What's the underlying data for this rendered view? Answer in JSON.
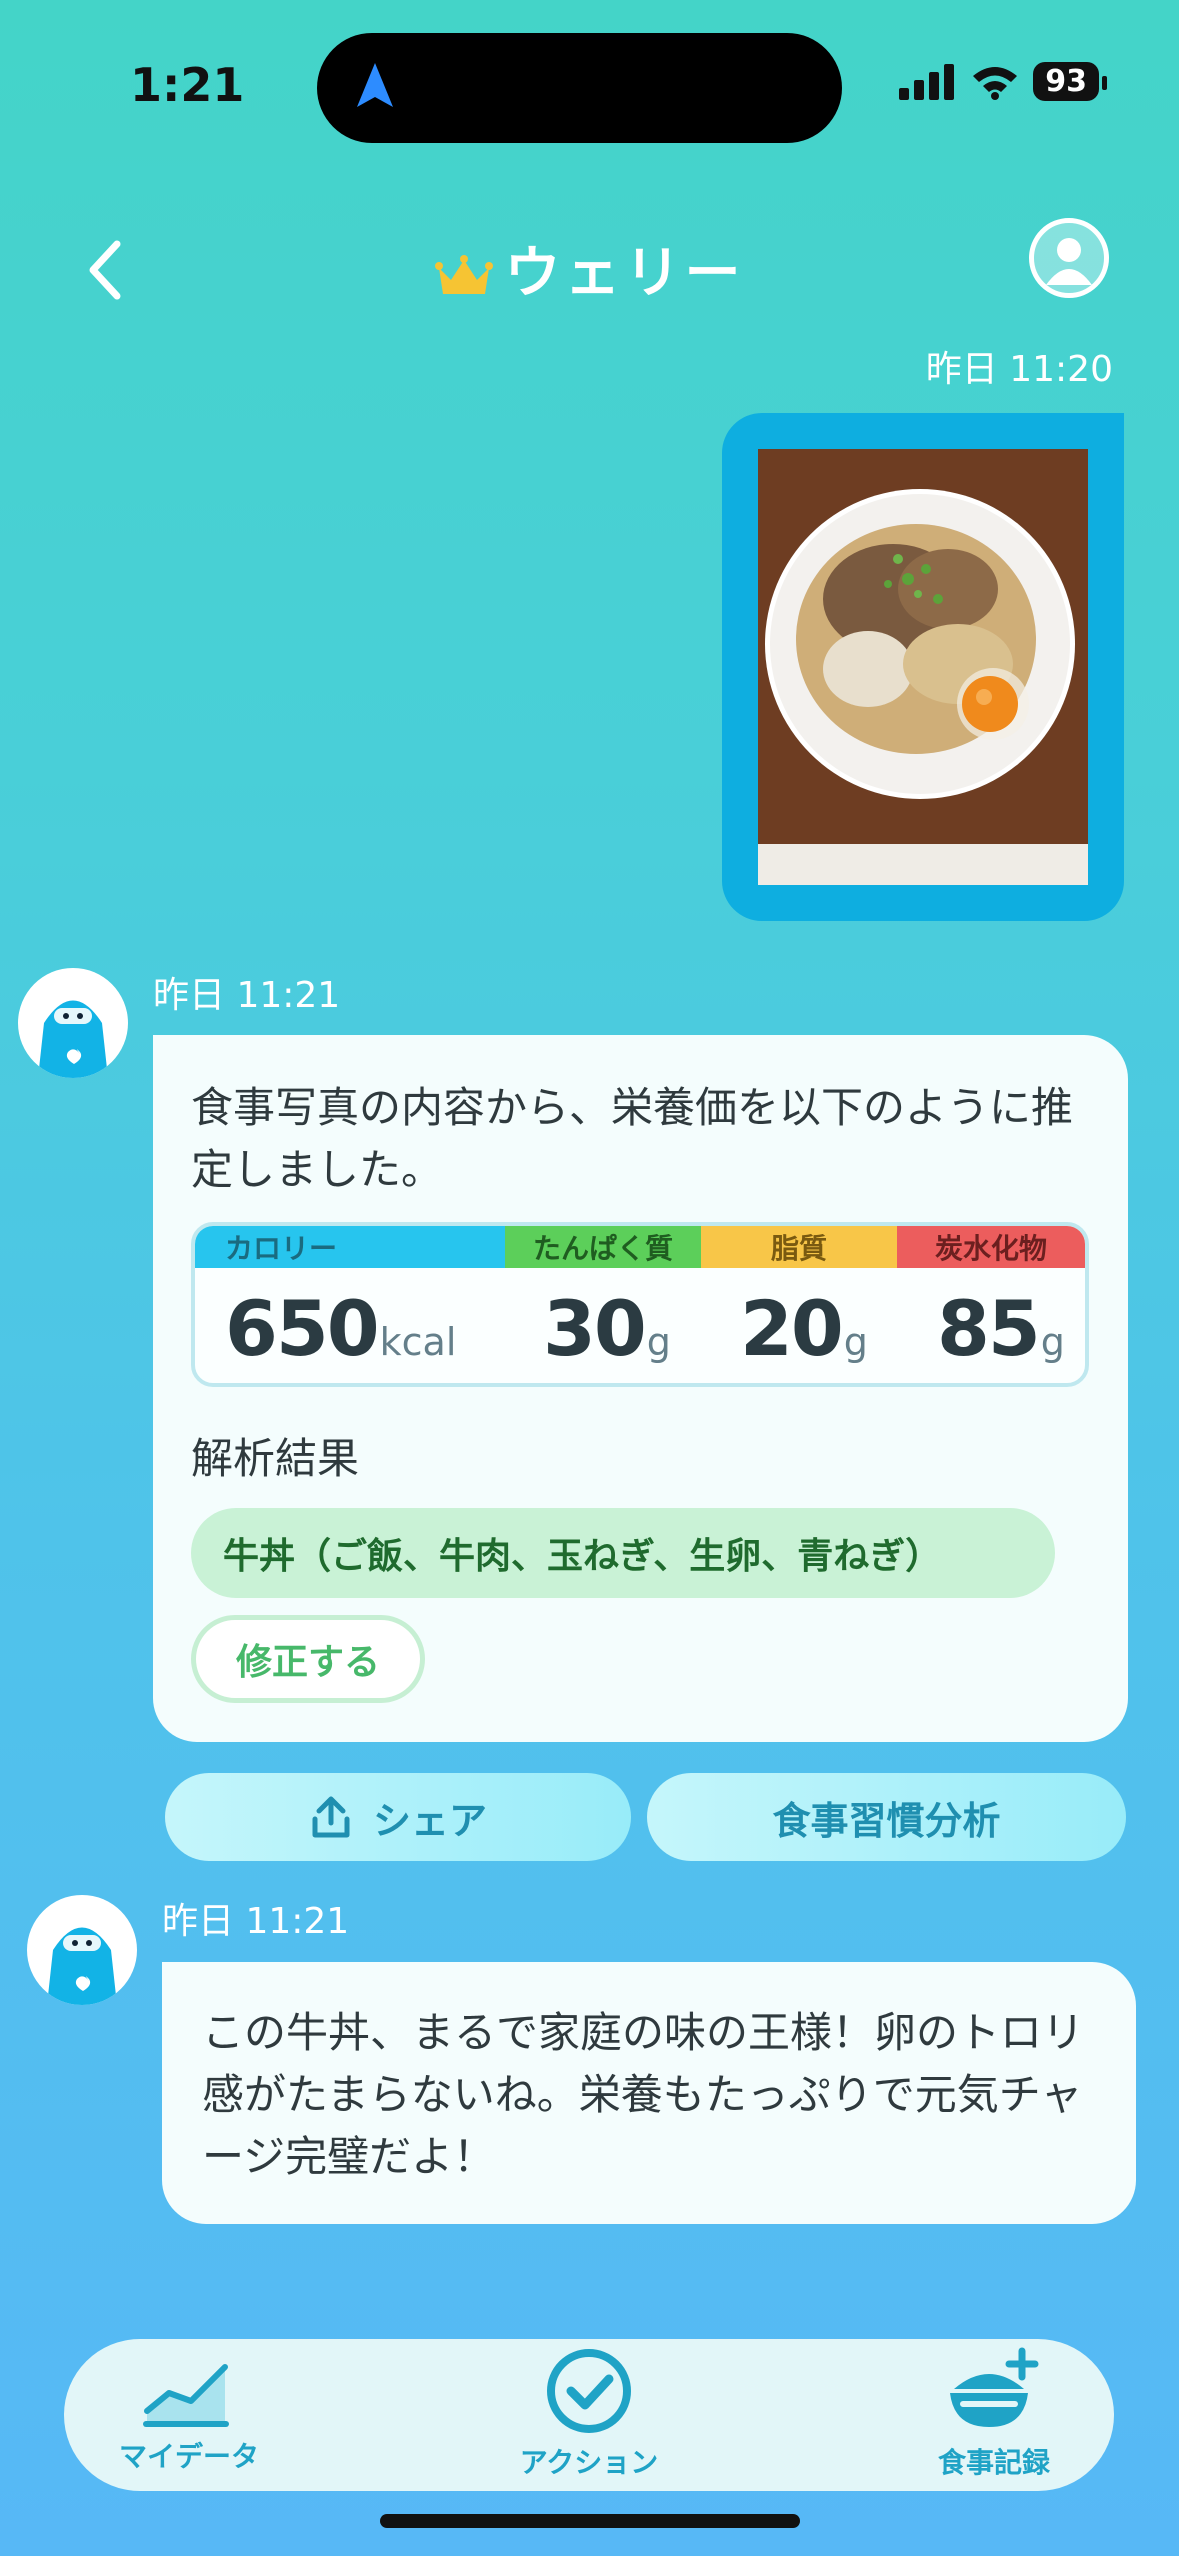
{
  "status": {
    "time": "1:21",
    "battery": "93"
  },
  "header": {
    "title": "ウェリー"
  },
  "chat": {
    "photo_timestamp": "昨日 11:20",
    "analysis_timestamp": "昨日 11:21",
    "analysis_text": "食事写真の内容から、栄養価を以下のように推定しました。",
    "nutrition": {
      "calorie_label": "カロリー",
      "calorie_value": "650",
      "calorie_unit": "kcal",
      "protein_label": "たんぱく質",
      "protein_value": "30",
      "protein_unit": "g",
      "fat_label": "脂質",
      "fat_value": "20",
      "fat_unit": "g",
      "carb_label": "炭水化物",
      "carb_value": "85",
      "carb_unit": "g"
    },
    "result_label": "解析結果",
    "result_value": "牛丼（ご飯、牛肉、玉ねぎ、生卵、青ねぎ）",
    "edit_label": "修正する",
    "share_label": "シェア",
    "habit_label": "食事習慣分析",
    "comment_timestamp": "昨日 11:21",
    "comment_text": "この牛丼、まるで家庭の味の王様！卵のトロリ感がたまらないね。栄養もたっぷりで元気チャージ完璧だよ！"
  },
  "tabs": {
    "mydata": "マイデータ",
    "action": "アクション",
    "meal": "食事記録"
  },
  "colors": {
    "accent": "#0eaee0",
    "calorie": "#27c5ee",
    "protein": "#5ccf5a",
    "fat": "#f8c648",
    "carb": "#ec5d5d"
  }
}
